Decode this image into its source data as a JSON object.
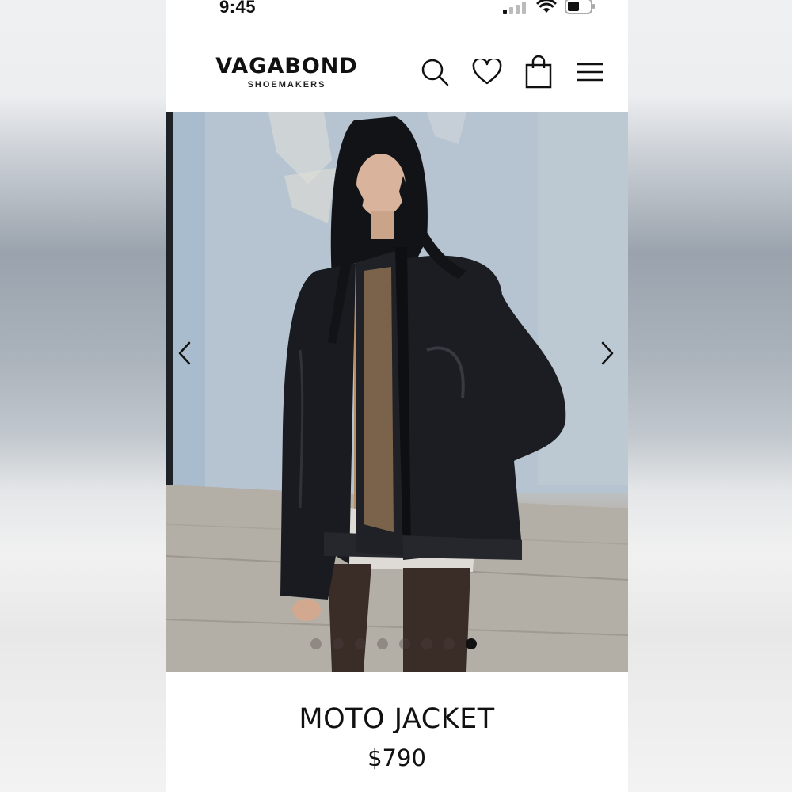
{
  "status_bar": {
    "time": "9:45",
    "icons": [
      "cellular-signal-icon",
      "wifi-icon",
      "battery-icon"
    ]
  },
  "header": {
    "brand_name": "VAGABOND",
    "brand_sub": "SHOEMAKERS",
    "icons": [
      "search-icon",
      "heart-icon",
      "shopping-bag-icon",
      "hamburger-menu-icon"
    ]
  },
  "gallery": {
    "prev_icon": "chevron-left-icon",
    "next_icon": "chevron-right-icon",
    "slide_count": 8,
    "active_slide": 8
  },
  "product": {
    "title": "MOTO JACKET",
    "price": "$790"
  },
  "colors": {
    "text": "#111111",
    "background": "#ffffff",
    "dot_inactive": "#8a7f78",
    "dot_active": "#111111"
  }
}
